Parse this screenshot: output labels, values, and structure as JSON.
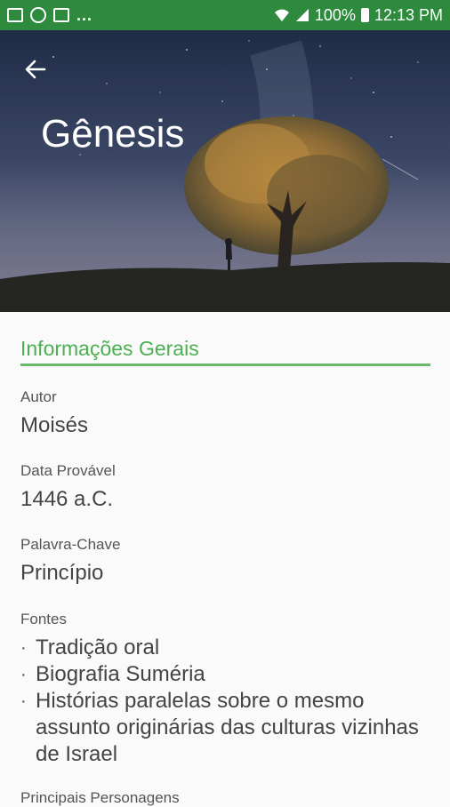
{
  "statusbar": {
    "battery": "100%",
    "time": "12:13 PM",
    "overflow": "..."
  },
  "hero": {
    "title": "Gênesis"
  },
  "section": {
    "title": "Informações Gerais"
  },
  "fields": [
    {
      "label": "Autor",
      "value": "Moisés"
    },
    {
      "label": "Data Provável",
      "value": "1446 a.C."
    },
    {
      "label": "Palavra-Chave",
      "value": "Princípio"
    }
  ],
  "fontes": {
    "label": "Fontes",
    "items": [
      "Tradição oral",
      "Biografia Suméria",
      "Histórias paralelas sobre o mesmo assunto originárias das culturas vizinhas de Israel"
    ]
  },
  "next_label": "Principais Personagens",
  "colors": {
    "statusbar": "#2e8b3e",
    "accent": "#4caf50"
  },
  "icons": [
    "image-icon",
    "sync-icon",
    "flipboard-icon",
    "wifi-icon",
    "signal-icon",
    "battery-icon",
    "back-arrow-icon"
  ]
}
